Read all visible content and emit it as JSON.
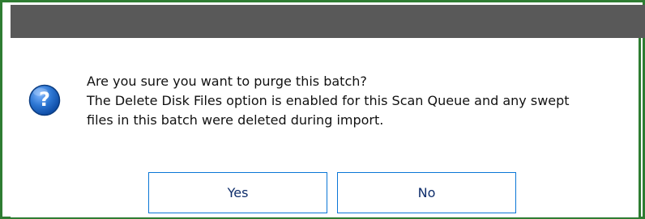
{
  "dialog": {
    "icon": "question-icon",
    "message_lines": [
      "Are you sure you want to purge this batch?",
      "The Delete Disk Files option is enabled for this Scan Queue and any swept",
      "files in this batch were deleted during import."
    ],
    "buttons": {
      "yes_label": "Yes",
      "no_label": "No"
    }
  },
  "colors": {
    "titlebar": "#595959",
    "accent_border": "#2e7d32",
    "button_border": "#0a76d6",
    "icon_blue": "#1f5fa8"
  }
}
